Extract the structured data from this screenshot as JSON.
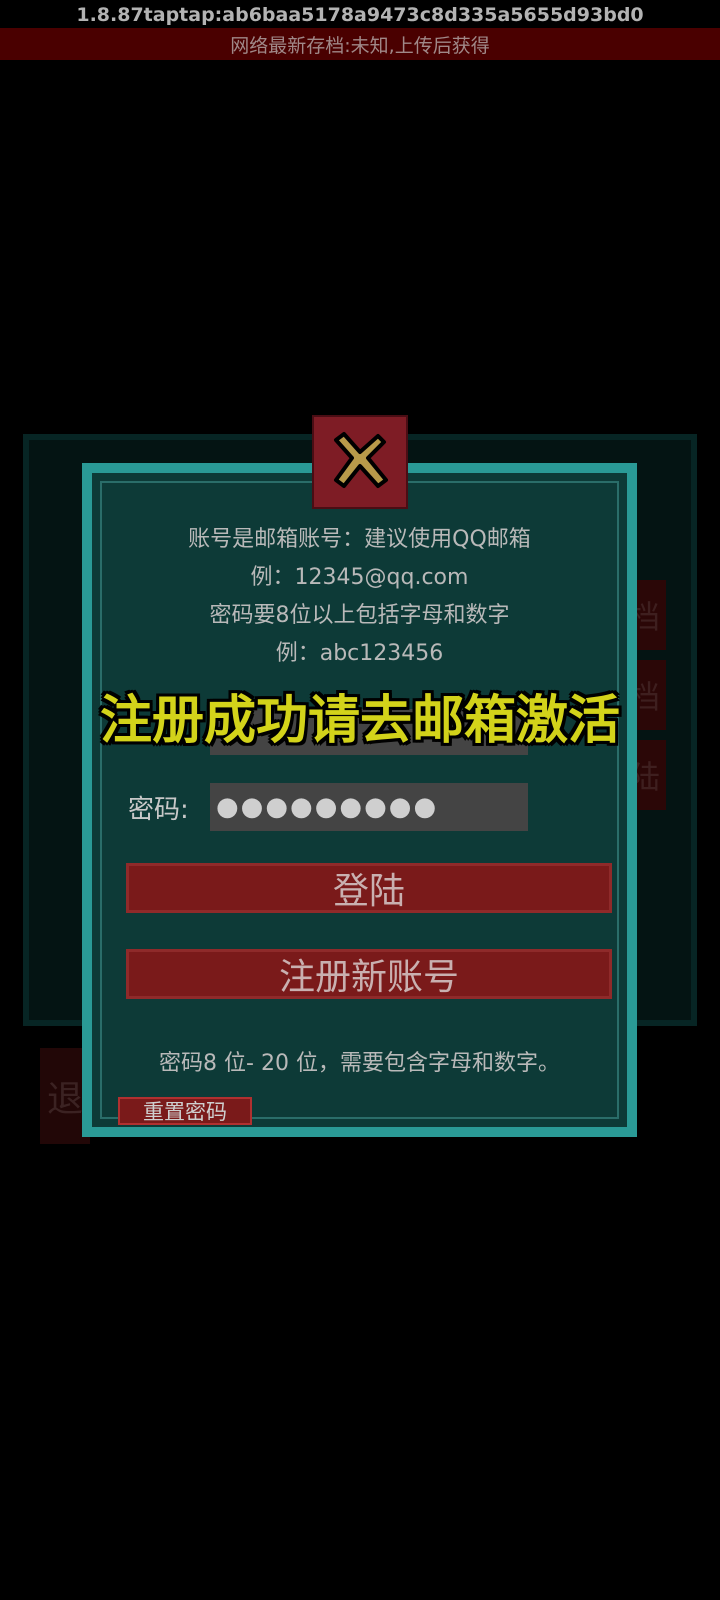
{
  "header": {
    "version": "1.8.87taptap:ab6baa5178a9473c8d335a5655d93bd0",
    "save_status": "网络最新存档:未知,上传后获得"
  },
  "dialog": {
    "help": {
      "line1": "账号是邮箱账号：建议使用QQ邮箱",
      "line2": "例：12345@qq.com",
      "line3": "密码要8位以上包括字母和数字",
      "line4": "例：abc123456"
    },
    "password_label": "密码:",
    "password_value": "●●●●●●●●●",
    "login_label": "登陆",
    "register_label": "注册新账号",
    "hint": "密码8 位- 20 位，需要包含字母和数字。",
    "reset_label": "重置密码"
  },
  "toast": {
    "message": "注册成功请去邮箱激活"
  },
  "background": {
    "side_buttons": [
      "档",
      "档",
      "陆"
    ],
    "exit_label": "退"
  },
  "colors": {
    "dialog_bg": "#0d3a37",
    "dialog_border": "#2a9a96",
    "button_bg": "#7a1a1a",
    "toast_text": "#d3d31a",
    "banner_bg": "#4a0000"
  },
  "icons": {
    "close": "close-x-icon"
  }
}
